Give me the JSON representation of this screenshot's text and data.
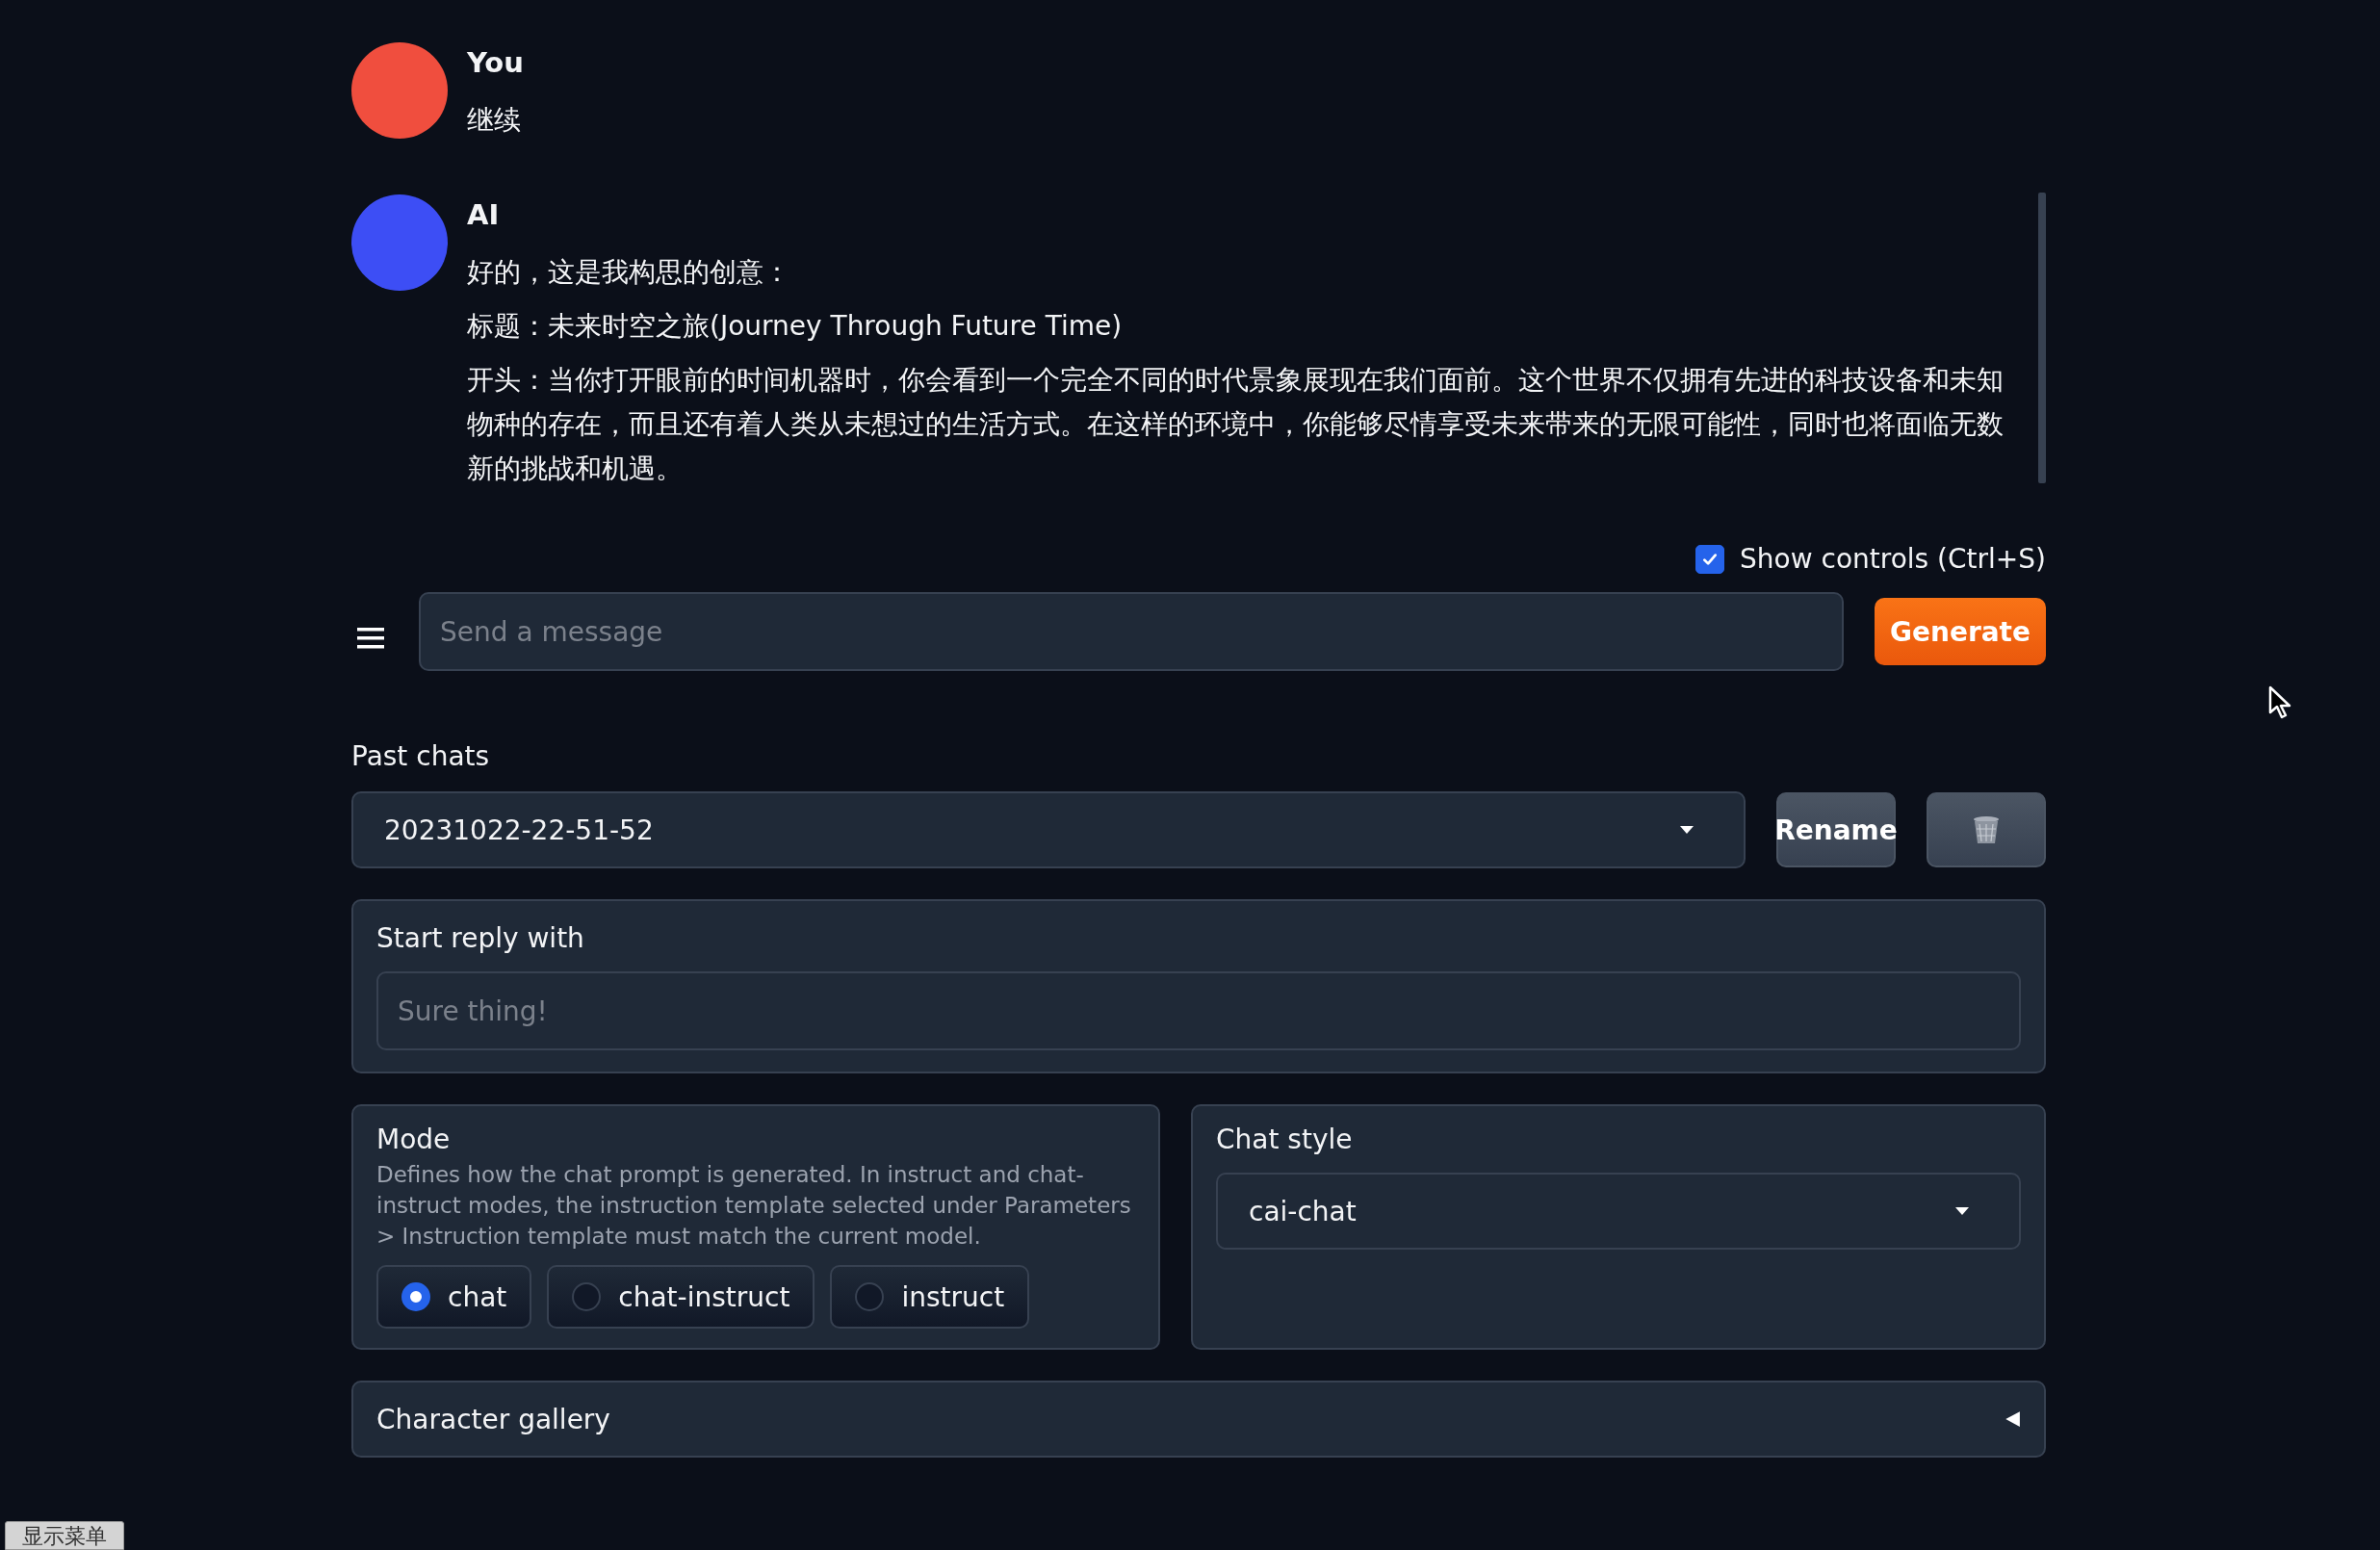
{
  "messages": [
    {
      "author": "You",
      "color": "#f04e3e",
      "paragraphs": [
        "继续"
      ]
    },
    {
      "author": "AI",
      "color": "#3d4ef5",
      "paragraphs": [
        "好的，这是我构思的创意：",
        "标题：未来时空之旅(Journey Through Future Time)",
        "开头：当你打开眼前的时间机器时，你会看到一个完全不同的时代景象展现在我们面前。这个世界不仅拥有先进的科技设备和未知物种的存在，而且还有着人类从未想过的生活方式。在这样的环境中，你能够尽情享受未来带来的无限可能性，同时也将面临无数新的挑战和机遇。"
      ]
    }
  ],
  "show_controls": {
    "label": "Show controls (Ctrl+S)",
    "checked": true
  },
  "message_input": {
    "placeholder": "Send a message"
  },
  "generate_button": "Generate",
  "past_chats": {
    "label": "Past chats",
    "value": "20231022-22-51-52",
    "rename_button": "Rename"
  },
  "start_reply": {
    "label": "Start reply with",
    "placeholder": "Sure thing!"
  },
  "mode": {
    "label": "Mode",
    "description": "Defines how the chat prompt is generated. In instruct and chat-instruct modes, the instruction template selected under Parameters > Instruction template must match the current model.",
    "options": [
      {
        "label": "chat",
        "selected": true
      },
      {
        "label": "chat-instruct",
        "selected": false
      },
      {
        "label": "instruct",
        "selected": false
      }
    ]
  },
  "chat_style": {
    "label": "Chat style",
    "value": "cai-chat"
  },
  "character_gallery": {
    "label": "Character gallery",
    "expanded": false
  },
  "menu_toggle_button": "显示菜单"
}
